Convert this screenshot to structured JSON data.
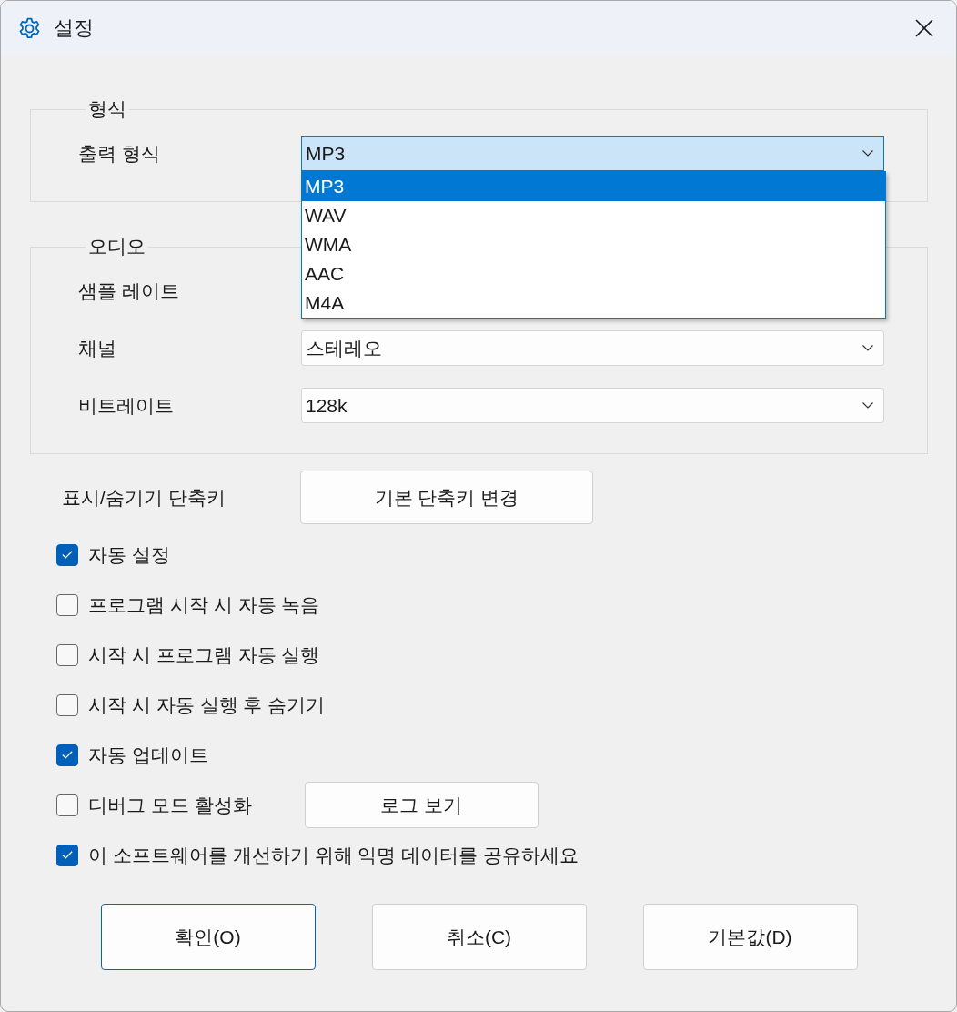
{
  "window": {
    "title": "설정"
  },
  "groups": [
    {
      "legend": "형식",
      "fields": [
        {
          "kind": "dropdown",
          "label": "출력 형식",
          "value": "MP3",
          "expanded": true,
          "options": [
            {
              "label": "MP3",
              "selected": true
            },
            {
              "label": "WAV",
              "selected": false
            },
            {
              "label": "WMA",
              "selected": false
            },
            {
              "label": "AAC",
              "selected": false
            },
            {
              "label": "M4A",
              "selected": false
            }
          ]
        }
      ]
    },
    {
      "legend": "오디오",
      "fields": [
        {
          "kind": "covered",
          "label": "샘플 레이트"
        },
        {
          "kind": "dropdown",
          "label": "채널",
          "value": "스테레오",
          "expanded": false
        },
        {
          "kind": "dropdown",
          "label": "비트레이트",
          "value": "128k",
          "expanded": false
        }
      ]
    }
  ],
  "hotkey": {
    "label": "표시/숨기기 단축키",
    "button": "기본 단축키 변경"
  },
  "options": [
    {
      "label": "자동 설정",
      "checked": true
    },
    {
      "label": "프로그램 시작 시 자동 녹음",
      "checked": false
    },
    {
      "label": "시작 시 프로그램 자동 실행",
      "checked": false
    },
    {
      "label": "시작 시 자동 실행 후 숨기기",
      "checked": false
    },
    {
      "label": "자동 업데이트",
      "checked": true
    },
    {
      "label": "디버그 모드 활성화",
      "checked": false,
      "button": "로그 보기"
    },
    {
      "label": "이 소프트웨어를 개선하기 위해 익명 데이터를 공유하세요",
      "checked": true
    }
  ],
  "buttons": [
    {
      "label": "확인(O)",
      "default": true
    },
    {
      "label": "취소(C)",
      "default": false
    },
    {
      "label": "기본값(D)",
      "default": false
    }
  ]
}
